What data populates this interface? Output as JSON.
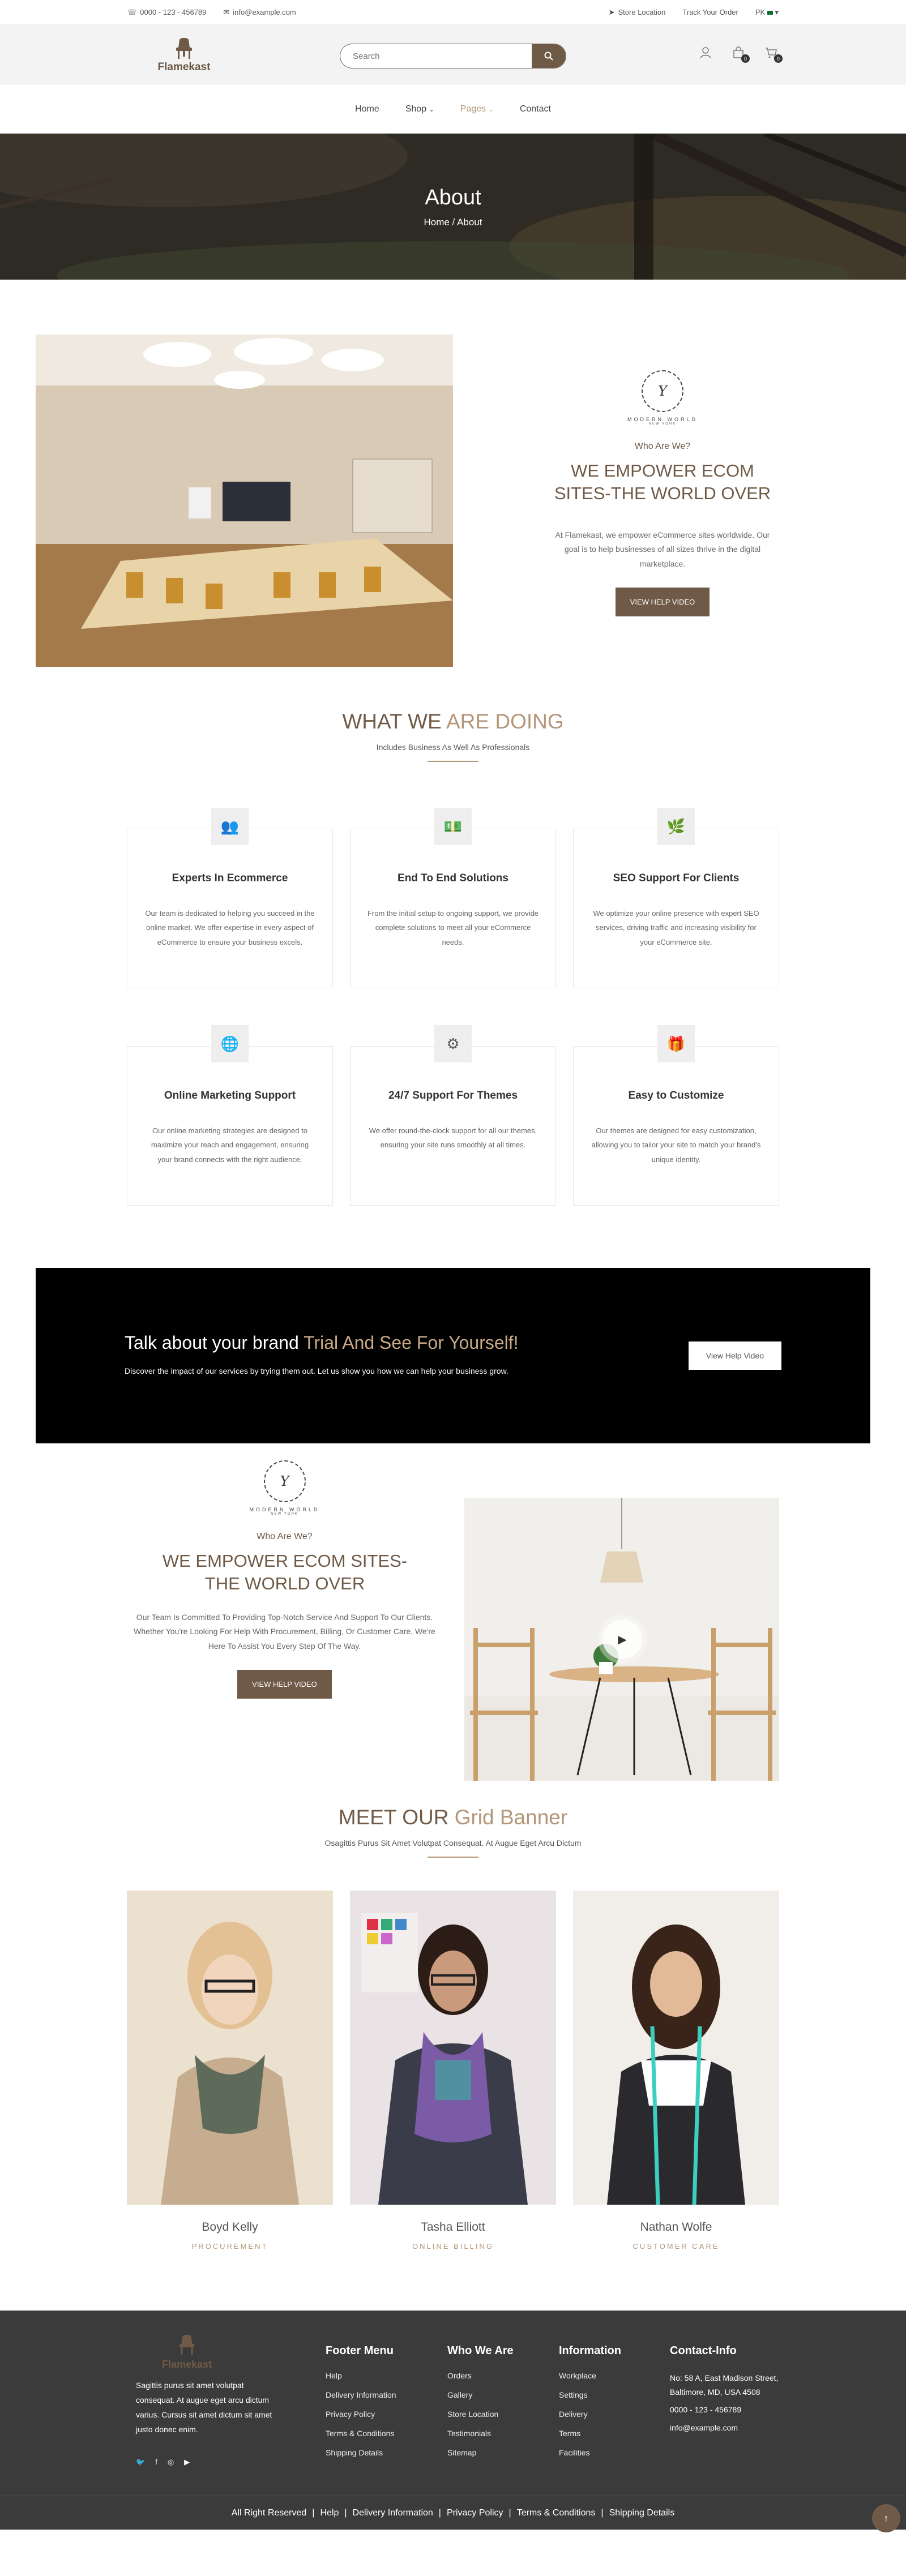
{
  "topbar": {
    "phone": "0000 - 123 - 456789",
    "email": "info@example.com",
    "store_location": "Store Location",
    "track_order": "Track Your Order",
    "language": "PK"
  },
  "header": {
    "brand": "Flamekast",
    "search_placeholder": "Search",
    "wishlist_count": "0",
    "cart_count": "0"
  },
  "nav": {
    "items": [
      "Home",
      "Shop",
      "Pages",
      "Contact"
    ]
  },
  "hero": {
    "title": "About",
    "breadcrumb": "Home / About"
  },
  "about": {
    "seal_letter": "Y",
    "seal_caption": "MODERN WORLD",
    "seal_sub": "NEW YORK",
    "who": "Who Are We?",
    "heading": "WE EMPOWER ECOM SITES-THE WORLD OVER",
    "paragraph": "At Flamekast, we empower eCommerce sites worldwide. Our goal is to help businesses of all sizes thrive in the digital marketplace.",
    "button": "VIEW HELP VIDEO"
  },
  "services": {
    "title_dark": "WHAT WE",
    "title_accent": "ARE DOING",
    "subtitle": "Includes Business As Well As Professionals",
    "cards": [
      {
        "icon": "users-icon",
        "glyph": "👥",
        "title": "Experts In Ecommerce",
        "text": "Our team is dedicated to helping you succeed in the online market. We offer expertise in every aspect of eCommerce to ensure your business excels."
      },
      {
        "icon": "money-icon",
        "glyph": "💵",
        "title": "End To End Solutions",
        "text": "From the initial setup to ongoing support, we provide complete solutions to meet all your eCommerce needs."
      },
      {
        "icon": "leaf-icon",
        "glyph": "🌿",
        "title": "SEO Support For Clients",
        "text": "We optimize your online presence with expert SEO services, driving traffic and increasing visibility for your eCommerce site."
      },
      {
        "icon": "globe-icon",
        "glyph": "🌐",
        "title": "Online Marketing Support",
        "text": "Our online marketing strategies are designed to maximize your reach and engagement, ensuring your brand connects with the right audience."
      },
      {
        "icon": "gear-icon",
        "glyph": "⚙",
        "title": "24/7 Support For Themes",
        "text": "We offer round-the-clock support for all our themes, ensuring your site runs smoothly at all times."
      },
      {
        "icon": "gift-icon",
        "glyph": "🎁",
        "title": "Easy to Customize",
        "text": "Our themes are designed for easy customization, allowing you to tailor your site to match your brand's unique identity."
      }
    ]
  },
  "banner": {
    "heading_white": "Talk about your brand",
    "heading_accent": "Trial And See For Yourself!",
    "text": "Discover the impact of our services by trying them out. Let us show you how we can help your business grow.",
    "button": "View Help Video"
  },
  "video_section": {
    "who": "Who Are We?",
    "heading": "WE EMPOWER ECOM SITES-THE WORLD OVER",
    "paragraph": "Our Team Is Committed To Providing Top-Notch Service And Support To Our Clients. Whether You're Looking For Help With Procurement, Billing, Or Customer Care, We're Here To Assist You Every Step Of The Way.",
    "button": "VIEW HELP VIDEO"
  },
  "team": {
    "title_dark": "MEET OUR",
    "title_accent": "Grid Banner",
    "subtitle": "Osagittis Purus Sit Amet Volutpat Consequat. At Augue Eget Arcu Dictum",
    "members": [
      {
        "name": "Boyd Kelly",
        "role": "PROCUREMENT"
      },
      {
        "name": "Tasha Elliott",
        "role": "ONLINE BILLING"
      },
      {
        "name": "Nathan Wolfe",
        "role": "CUSTOMER CARE"
      }
    ]
  },
  "footer": {
    "brand": "Flamekast",
    "description": "Sagittis purus sit amet volutpat consequat. At augue eget arcu dictum varius. Cursus sit amet dictum sit amet justo donec enim.",
    "columns": [
      {
        "title": "Footer Menu",
        "items": [
          "Help",
          "Delivery Information",
          "Privacy Policy",
          "Terms & Conditions",
          "Shipping Details"
        ]
      },
      {
        "title": "Who We Are",
        "items": [
          "Orders",
          "Gallery",
          "Store Location",
          "Testimonials",
          "Sitemap"
        ]
      },
      {
        "title": "Information",
        "items": [
          "Workplace",
          "Settings",
          "Delivery",
          "Terms",
          "Facilities"
        ]
      }
    ],
    "contact": {
      "title": "Contact-Info",
      "address": "No: 58 A, East Madison Street, Baltimore, MD, USA 4508",
      "phone": "0000 - 123 - 456789",
      "email": "info@example.com"
    },
    "bottom": [
      "All Right Reserved",
      "Help",
      "Delivery Information",
      "Privacy Policy",
      "Terms & Conditions",
      "Shipping Details"
    ]
  }
}
